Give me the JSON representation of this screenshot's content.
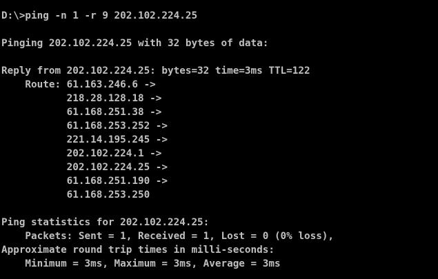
{
  "console": {
    "background": "#000000",
    "foreground": "#c0c0c0",
    "command_line": "D:\\>ping -n 1 -r 9 202.102.224.25",
    "pinging_line": "Pinging 202.102.224.25 with 32 bytes of data:",
    "reply_line": "Reply from 202.102.224.25: bytes=32 time=3ms TTL=122",
    "route_lines": [
      "    Route: 61.163.246.6 ->",
      "           218.28.128.18 ->",
      "           61.168.251.38 ->",
      "           61.168.253.252 ->",
      "           221.14.195.245 ->",
      "           202.102.224.1 ->",
      "           202.102.224.25 ->",
      "           61.168.251.190 ->",
      "           61.168.253.250"
    ],
    "stats_header": "Ping statistics for 202.102.224.25:",
    "packets_line": "    Packets: Sent = 1, Received = 1, Lost = 0 (0% loss),",
    "rtt_header": "Approximate round trip times in milli-seconds:",
    "rtt_line": "    Minimum = 3ms, Maximum = 3ms, Average = 3ms"
  }
}
